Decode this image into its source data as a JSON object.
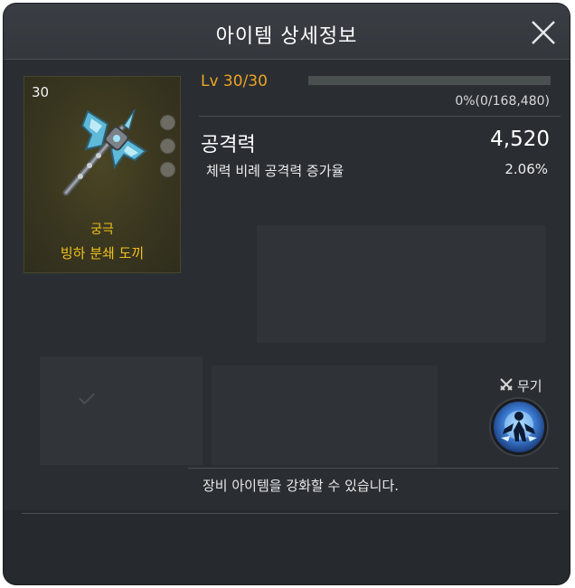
{
  "header": {
    "title": "아이템 상세정보",
    "close_icon": "close-icon"
  },
  "item": {
    "level": "30",
    "grade": "궁극",
    "name": "빙하 분쇄 도끼",
    "image_icon": "axe-weapon-icon",
    "slot_count": 3
  },
  "level_info": {
    "label": "Lv 30/30",
    "exp_progress": 0,
    "exp_text": "0%(0/168,480)"
  },
  "stats": {
    "primary_name": "공격력",
    "primary_value": "4,520",
    "secondary_name": "체력 비례 공격력 증가율",
    "secondary_value": "2.06%"
  },
  "weapon": {
    "label": "무기",
    "tag_icon": "crossed-swords-icon",
    "skill_icon": "character-skill-icon"
  },
  "info": {
    "message": "장비 아이템을 강화할 수 있습니다."
  },
  "colors": {
    "accent_orange": "#eba322",
    "grade_gold": "#f0c11c",
    "panel_bg": "#2a2e33"
  }
}
